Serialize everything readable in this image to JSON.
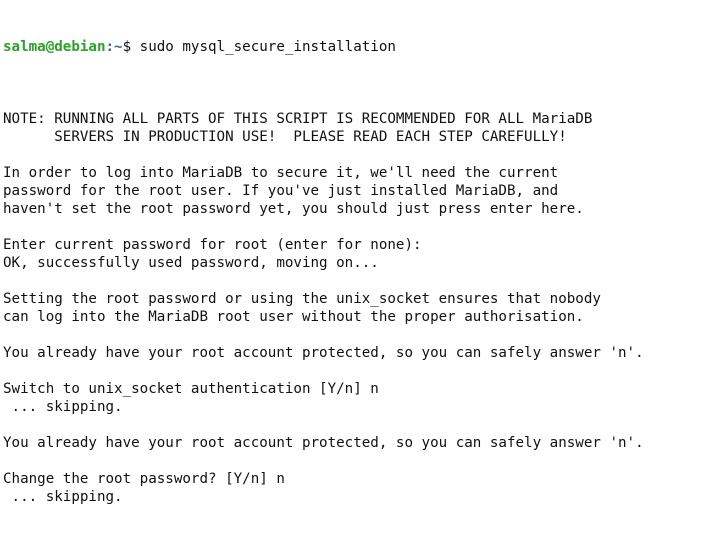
{
  "prompt": {
    "user_host": "salma@debian",
    "path": ":~",
    "symbol": "$",
    "command": " sudo mysql_secure_installation"
  },
  "output": [
    "",
    "NOTE: RUNNING ALL PARTS OF THIS SCRIPT IS RECOMMENDED FOR ALL MariaDB",
    "      SERVERS IN PRODUCTION USE!  PLEASE READ EACH STEP CAREFULLY!",
    "",
    "In order to log into MariaDB to secure it, we'll need the current",
    "password for the root user. If you've just installed MariaDB, and",
    "haven't set the root password yet, you should just press enter here.",
    "",
    "Enter current password for root (enter for none):",
    "OK, successfully used password, moving on...",
    "",
    "Setting the root password or using the unix_socket ensures that nobody",
    "can log into the MariaDB root user without the proper authorisation.",
    "",
    "You already have your root account protected, so you can safely answer 'n'.",
    "",
    "Switch to unix_socket authentication [Y/n] n",
    " ... skipping.",
    "",
    "You already have your root account protected, so you can safely answer 'n'.",
    "",
    "Change the root password? [Y/n] n",
    " ... skipping."
  ],
  "colors": {
    "user_host": "#2aa12a",
    "path": "#3465a4",
    "text": "#111111",
    "background": "#ffffff"
  }
}
